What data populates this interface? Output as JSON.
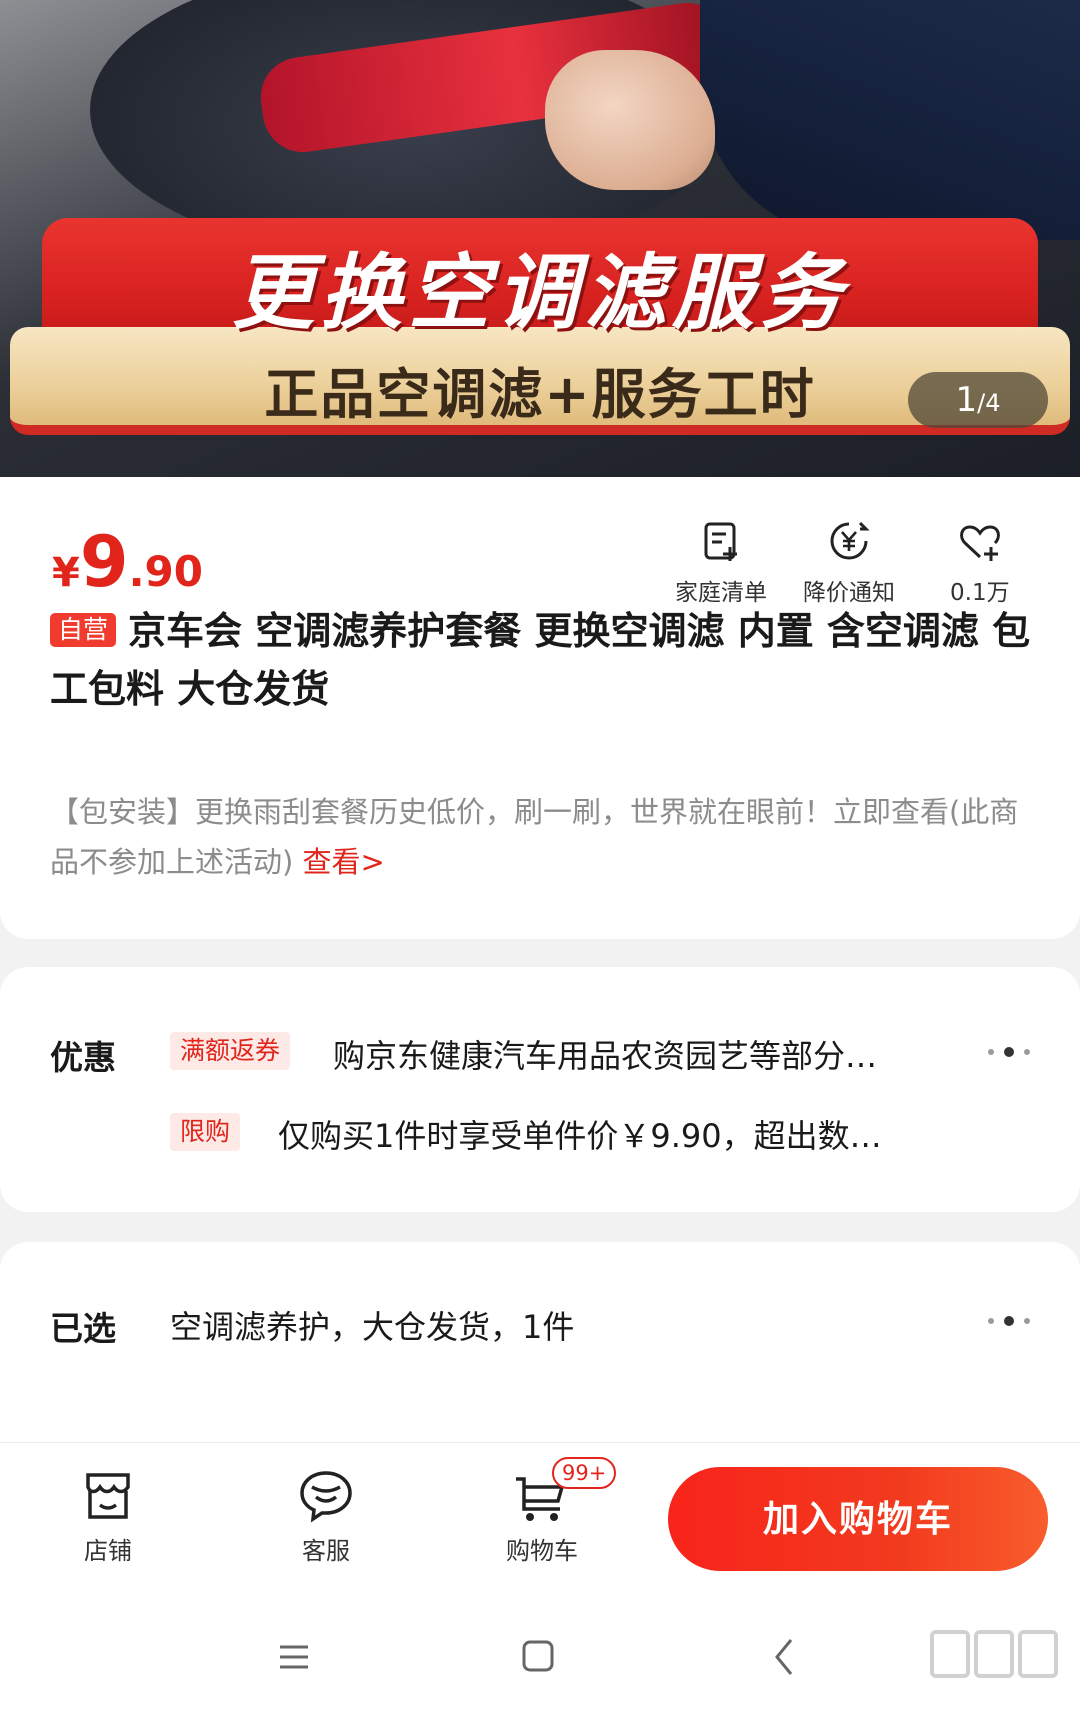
{
  "hero": {
    "banner_main": "更换空调滤服务",
    "banner_sub": "正品空调滤+服务工时",
    "counter_current": "1",
    "counter_total": "/4"
  },
  "product": {
    "price_symbol": "¥",
    "price_int": "9",
    "price_dec": ".90",
    "actions": {
      "family_list": "家庭清单",
      "price_alert": "降价通知",
      "favorite_count": "0.1万"
    },
    "self_tag": "自营",
    "title": "京车会 空调滤养护套餐 更换空调滤 内置 含空调滤 包工包料 大仓发货",
    "promo_text": "【包安装】更换雨刮套餐历史低价，刷一刷，世界就在眼前！立即查看(此商品不参加上述活动)",
    "promo_link": "查看>"
  },
  "offers": {
    "label": "优惠",
    "items": [
      {
        "tag": "满额返券",
        "text": "购京东健康汽车用品农资园艺等部分…"
      },
      {
        "tag": "限购",
        "text": "仅购买1件时享受单件价￥9.90，超出数…"
      }
    ]
  },
  "selected": {
    "label": "已选",
    "value": "空调滤养护，大仓发货，1件"
  },
  "bottombar": {
    "store": "店铺",
    "service": "客服",
    "cart": "购物车",
    "cart_badge": "99+",
    "add_to_cart": "加入购物车"
  },
  "colors": {
    "accent": "#e1251b",
    "button": "#f8241b",
    "tag_bg": "#fde9e6"
  },
  "icons": {
    "family_list": "list-add-icon",
    "price_alert": "yen-bell-icon",
    "favorite": "heart-plus-icon",
    "store": "store-icon",
    "service": "chat-face-icon",
    "cart": "cart-icon",
    "more": "more-dots-icon"
  }
}
